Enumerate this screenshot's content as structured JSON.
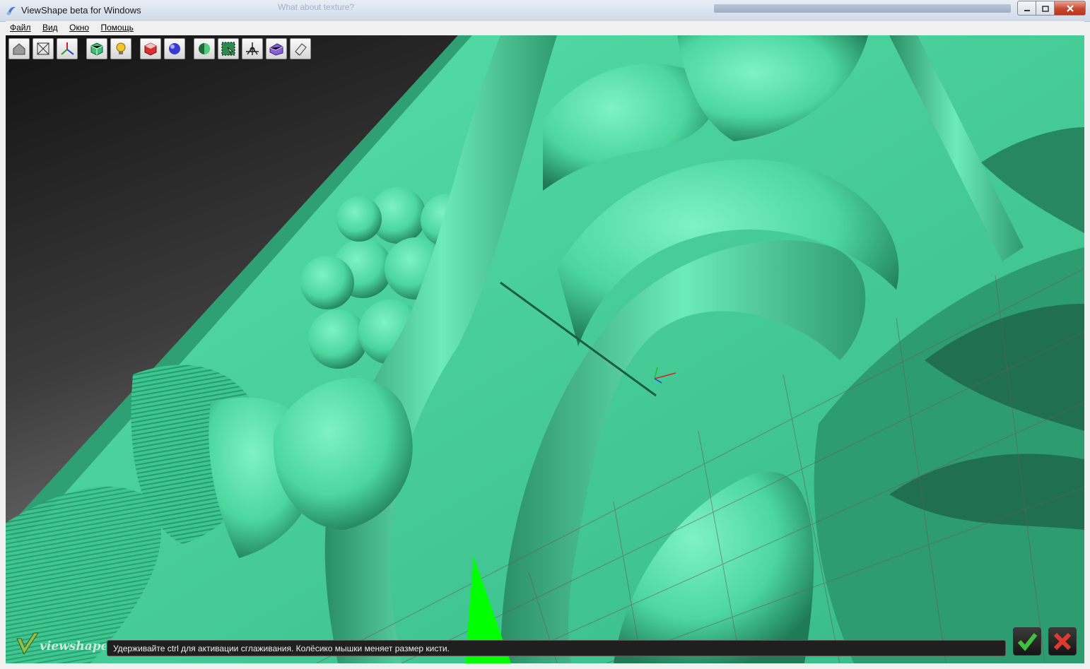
{
  "window": {
    "title": "ViewShape beta for Windows",
    "ghost_title": "What about texture?"
  },
  "menu": [
    {
      "label": "Файл"
    },
    {
      "label": "Вид"
    },
    {
      "label": "Окно"
    },
    {
      "label": "Помощь"
    }
  ],
  "toolbar": {
    "icons": [
      "home-view-icon",
      "fit-view-icon",
      "axes-icon",
      "shaded-cube-icon",
      "light-bulb-icon",
      "red-cube-icon",
      "sphere-icon",
      "half-sphere-icon",
      "select-area-icon",
      "transform-icon",
      "purple-cube-icon",
      "eraser-icon"
    ]
  },
  "status": {
    "message": "Удерживайте ctrl для активации сглаживания. Колёсико мышки меняет размер кисти."
  },
  "logo": {
    "text": "viewshape"
  },
  "colors": {
    "mesh": "#4fdba3",
    "mesh_dark": "#1d6b4d",
    "accept": "#3ec13e",
    "reject": "#e03a2f"
  }
}
